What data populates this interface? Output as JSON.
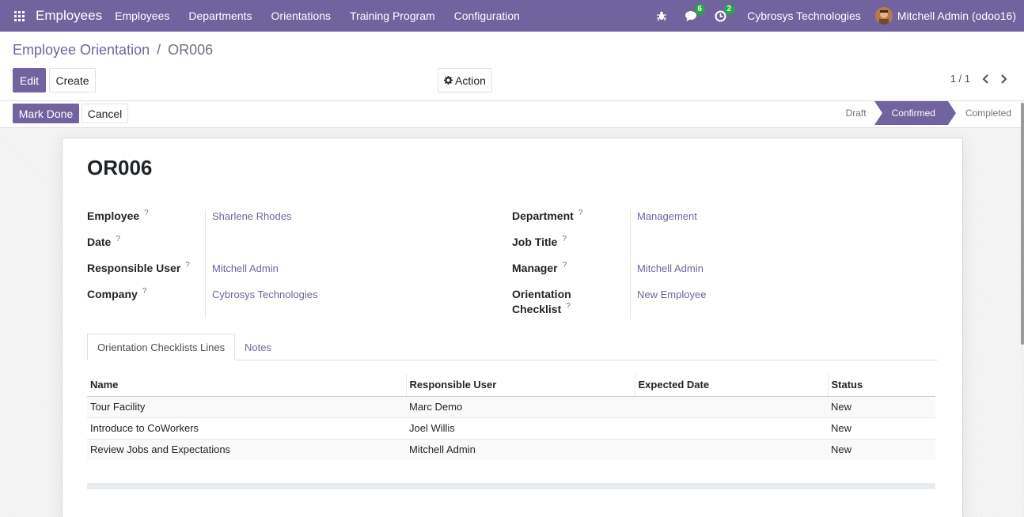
{
  "navbar": {
    "app_name": "Employees",
    "menu": [
      "Employees",
      "Departments",
      "Orientations",
      "Training Program",
      "Configuration"
    ],
    "messages_count": "6",
    "activities_count": "2",
    "company": "Cybrosys Technologies",
    "user": "Mitchell Admin (odoo16)"
  },
  "breadcrumb": {
    "parent": "Employee Orientation",
    "separator": "/",
    "current": "OR006"
  },
  "control": {
    "edit_label": "Edit",
    "create_label": "Create",
    "action_label": "Action",
    "pager": "1 / 1"
  },
  "statusbar": {
    "mark_done_label": "Mark Done",
    "cancel_label": "Cancel",
    "steps": [
      "Draft",
      "Confirmed",
      "Completed"
    ],
    "active_step": "Confirmed"
  },
  "record": {
    "title": "OR006",
    "help_mark": "?",
    "left_fields": [
      {
        "label": "Employee",
        "value": "Sharlene Rhodes"
      },
      {
        "label": "Date",
        "value": ""
      },
      {
        "label": "Responsible User",
        "value": "Mitchell Admin"
      },
      {
        "label": "Company",
        "value": "Cybrosys Technologies"
      }
    ],
    "right_fields": [
      {
        "label": "Department",
        "value": "Management"
      },
      {
        "label": "Job Title",
        "value": ""
      },
      {
        "label": "Manager",
        "value": "Mitchell Admin"
      },
      {
        "label_line1": "Orientation",
        "label_line2": "Checklist",
        "value": "New Employee"
      }
    ]
  },
  "tabs": [
    "Orientation Checklists Lines",
    "Notes"
  ],
  "lines_table": {
    "columns": [
      "Name",
      "Responsible User",
      "Expected Date",
      "Status"
    ],
    "rows": [
      [
        "Tour Facility",
        "Marc Demo",
        "",
        "New"
      ],
      [
        "Introduce to CoWorkers",
        "Joel Willis",
        "",
        "New"
      ],
      [
        "Review Jobs and Expectations",
        "Mitchell Admin",
        "",
        "New"
      ]
    ]
  },
  "colors": {
    "brand": "#71639e",
    "badge": "#28a745"
  }
}
